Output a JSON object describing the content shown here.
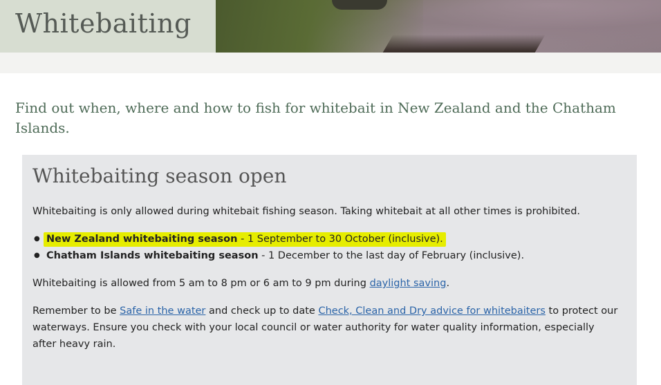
{
  "header": {
    "title": "Whitebaiting"
  },
  "intro": {
    "text": "Find out when, where and how to fish for whitebait in New Zealand and the Chatham Islands."
  },
  "panel": {
    "heading": "Whitebaiting season open",
    "p1": "Whitebaiting is only allowed during whitebait fishing season. Taking whitebait at all other times is prohibited.",
    "seasons": [
      {
        "name": "New Zealand whitebaiting season",
        "detail": " - 1 September to 30 October (inclusive)."
      },
      {
        "name": "Chatham Islands whitebaiting season",
        "detail": " - 1 December to the last day of February (inclusive)."
      }
    ],
    "p2_before": "Whitebaiting is allowed from 5 am to 8 pm or 6 am to 9 pm during ",
    "p2_link": "daylight saving",
    "p2_after": ".",
    "p3_a": "Remember to be ",
    "p3_link1": "Safe in the water",
    "p3_b": " and check up to date ",
    "p3_link2": "Check, Clean and Dry advice for whitebaiters",
    "p3_c": " to protect our waterways. Ensure you check with your local council or water authority for water quality information, especially after heavy rain."
  },
  "colors": {
    "highlight": "#e6ed00",
    "link": "#2b64a8",
    "intro_text": "#4e6b57",
    "panel_bg": "#e6e7e9"
  }
}
